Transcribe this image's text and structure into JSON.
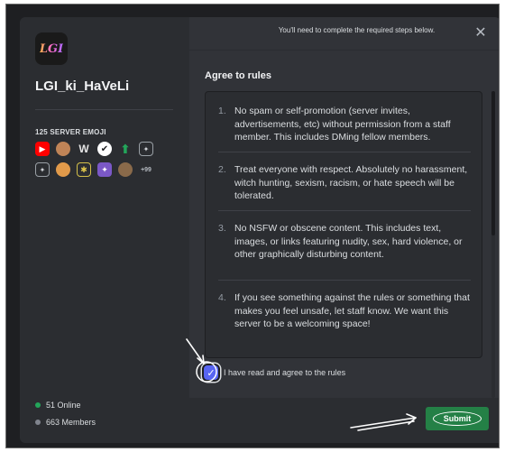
{
  "server": {
    "icon_text": "LGI",
    "name": "LGI_ki_HaVeLi",
    "emoji_header": "125 SERVER EMOJI",
    "emoji_more": "+99",
    "online": "51 Online",
    "members": "663 Members"
  },
  "modal": {
    "header_text": "You'll need to complete the required steps below.",
    "close_symbol": "✕",
    "section_title": "Agree to rules",
    "rules": [
      {
        "num": "1.",
        "text": "No spam or self-promotion (server invites, advertisements, etc) without permission from a staff member. This includes DMing fellow members."
      },
      {
        "num": "2.",
        "text": "Treat everyone with respect. Absolutely no harassment, witch hunting, sexism, racism, or hate speech will be tolerated."
      },
      {
        "num": "3.",
        "text": "No NSFW or obscene content. This includes text, images, or links featuring nudity, sex, hard violence, or other graphically disturbing content."
      },
      {
        "num": "4.",
        "text": "If you see something against the rules or something that makes you feel unsafe, let staff know. We want this server to be a welcoming space!"
      }
    ],
    "agree_label": "I have read and agree to the rules",
    "checkbox_mark": "✓",
    "submit_label": "Submit"
  },
  "colors": {
    "accent": "#5865f2",
    "submit": "#248046",
    "online_dot": "#23a55a"
  }
}
